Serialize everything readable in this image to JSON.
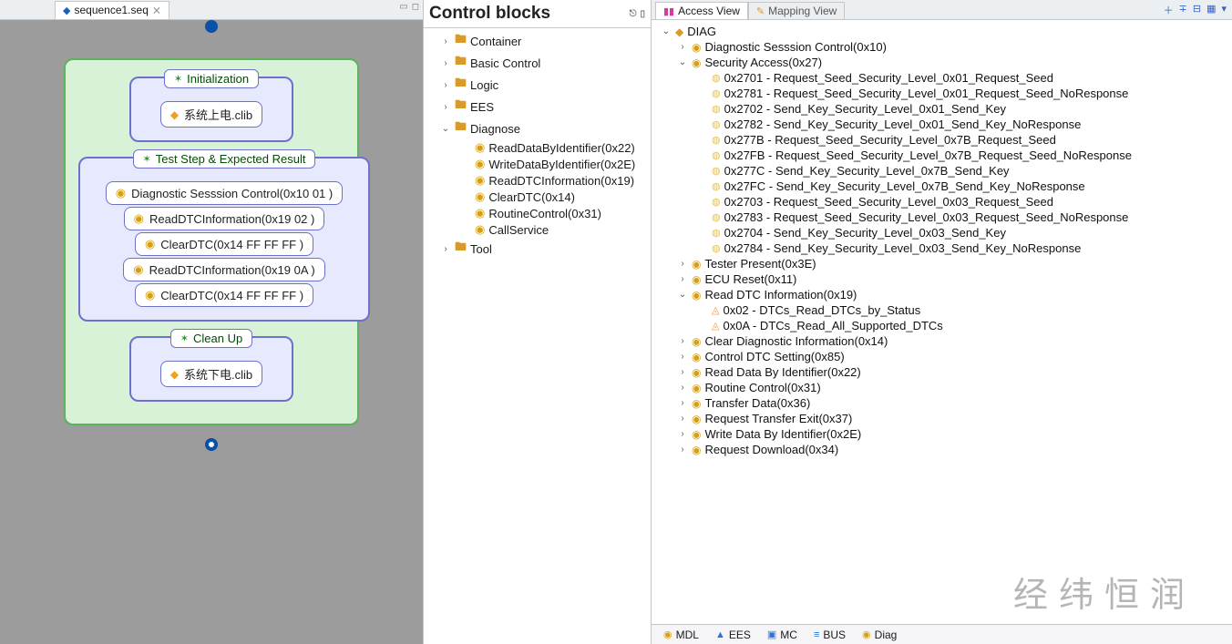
{
  "editor": {
    "tab_title": "sequence1.seq",
    "phases": {
      "init": {
        "title": "Initialization",
        "block": "系统上电.clib"
      },
      "test": {
        "title": "Test Step & Expected Result",
        "steps": [
          "Diagnostic Sesssion Control(0x10 01 )",
          "ReadDTCInformation(0x19 02 )",
          "ClearDTC(0x14 FF FF FF )",
          "ReadDTCInformation(0x19 0A )",
          "ClearDTC(0x14 FF FF FF )"
        ]
      },
      "cleanup": {
        "title": "Clean Up",
        "block": "系统下电.clib"
      }
    }
  },
  "palette": {
    "title": "Control blocks",
    "items": [
      {
        "label": "Container",
        "type": "folder",
        "depth": 1,
        "tw": "›"
      },
      {
        "label": "Basic Control",
        "type": "folder",
        "depth": 1,
        "tw": "›"
      },
      {
        "label": "Logic",
        "type": "folder",
        "depth": 1,
        "tw": "›"
      },
      {
        "label": "EES",
        "type": "folder",
        "depth": 1,
        "tw": "›"
      },
      {
        "label": "Diagnose",
        "type": "folder",
        "depth": 1,
        "tw": "⌄"
      },
      {
        "label": "ReadDataByIdentifier(0x22)",
        "type": "leaf",
        "depth": 2,
        "tw": ""
      },
      {
        "label": "WriteDataByIdentifier(0x2E)",
        "type": "leaf",
        "depth": 2,
        "tw": ""
      },
      {
        "label": "ReadDTCInformation(0x19)",
        "type": "leaf",
        "depth": 2,
        "tw": ""
      },
      {
        "label": "ClearDTC(0x14)",
        "type": "leaf",
        "depth": 2,
        "tw": ""
      },
      {
        "label": "RoutineControl(0x31)",
        "type": "leaf",
        "depth": 2,
        "tw": ""
      },
      {
        "label": "CallService",
        "type": "leaf",
        "depth": 2,
        "tw": ""
      },
      {
        "label": "Tool",
        "type": "folder",
        "depth": 1,
        "tw": "›"
      }
    ]
  },
  "views": {
    "tabs": {
      "access": "Access View",
      "mapping": "Mapping View"
    },
    "toolbar_icons": [
      "plus-icon",
      "filter-icon",
      "collapse-icon",
      "grid-icon",
      "menu-icon"
    ],
    "tree": [
      {
        "d": 0,
        "tw": "⌄",
        "ic": "iYellow",
        "g": "◆",
        "lbl": "DIAG"
      },
      {
        "d": 1,
        "tw": "›",
        "ic": "iGear",
        "g": "◉",
        "lbl": "Diagnostic Sesssion Control(0x10)"
      },
      {
        "d": 1,
        "tw": "⌄",
        "ic": "iGear",
        "g": "◉",
        "lbl": "Security Access(0x27)"
      },
      {
        "d": 2,
        "tw": "",
        "ic": "iCirc",
        "g": "◍",
        "lbl": "0x2701 - Request_Seed_Security_Level_0x01_Request_Seed"
      },
      {
        "d": 2,
        "tw": "",
        "ic": "iCirc",
        "g": "◍",
        "lbl": "0x2781 - Request_Seed_Security_Level_0x01_Request_Seed_NoResponse"
      },
      {
        "d": 2,
        "tw": "",
        "ic": "iCirc",
        "g": "◍",
        "lbl": "0x2702 - Send_Key_Security_Level_0x01_Send_Key"
      },
      {
        "d": 2,
        "tw": "",
        "ic": "iCirc",
        "g": "◍",
        "lbl": "0x2782 - Send_Key_Security_Level_0x01_Send_Key_NoResponse"
      },
      {
        "d": 2,
        "tw": "",
        "ic": "iCirc",
        "g": "◍",
        "lbl": "0x277B - Request_Seed_Security_Level_0x7B_Request_Seed"
      },
      {
        "d": 2,
        "tw": "",
        "ic": "iCirc",
        "g": "◍",
        "lbl": "0x27FB - Request_Seed_Security_Level_0x7B_Request_Seed_NoResponse"
      },
      {
        "d": 2,
        "tw": "",
        "ic": "iCirc",
        "g": "◍",
        "lbl": "0x277C - Send_Key_Security_Level_0x7B_Send_Key"
      },
      {
        "d": 2,
        "tw": "",
        "ic": "iCirc",
        "g": "◍",
        "lbl": "0x27FC - Send_Key_Security_Level_0x7B_Send_Key_NoResponse"
      },
      {
        "d": 2,
        "tw": "",
        "ic": "iCirc",
        "g": "◍",
        "lbl": "0x2703 - Request_Seed_Security_Level_0x03_Request_Seed"
      },
      {
        "d": 2,
        "tw": "",
        "ic": "iCirc",
        "g": "◍",
        "lbl": "0x2783 - Request_Seed_Security_Level_0x03_Request_Seed_NoResponse"
      },
      {
        "d": 2,
        "tw": "",
        "ic": "iCirc",
        "g": "◍",
        "lbl": "0x2704 - Send_Key_Security_Level_0x03_Send_Key"
      },
      {
        "d": 2,
        "tw": "",
        "ic": "iCirc",
        "g": "◍",
        "lbl": "0x2784 - Send_Key_Security_Level_0x03_Send_Key_NoResponse"
      },
      {
        "d": 1,
        "tw": "›",
        "ic": "iGear",
        "g": "◉",
        "lbl": "Tester Present(0x3E)"
      },
      {
        "d": 1,
        "tw": "›",
        "ic": "iGear",
        "g": "◉",
        "lbl": "ECU Reset(0x11)"
      },
      {
        "d": 1,
        "tw": "⌄",
        "ic": "iGear",
        "g": "◉",
        "lbl": "Read DTC Information(0x19)"
      },
      {
        "d": 2,
        "tw": "",
        "ic": "iTri",
        "g": "◬",
        "lbl": "0x02 - DTCs_Read_DTCs_by_Status"
      },
      {
        "d": 2,
        "tw": "",
        "ic": "iTri",
        "g": "◬",
        "lbl": "0x0A - DTCs_Read_All_Supported_DTCs"
      },
      {
        "d": 1,
        "tw": "›",
        "ic": "iGear",
        "g": "◉",
        "lbl": "Clear Diagnostic Information(0x14)"
      },
      {
        "d": 1,
        "tw": "›",
        "ic": "iGear",
        "g": "◉",
        "lbl": "Control DTC Setting(0x85)"
      },
      {
        "d": 1,
        "tw": "›",
        "ic": "iGear",
        "g": "◉",
        "lbl": "Read Data By Identifier(0x22)"
      },
      {
        "d": 1,
        "tw": "›",
        "ic": "iGear",
        "g": "◉",
        "lbl": "Routine Control(0x31)"
      },
      {
        "d": 1,
        "tw": "›",
        "ic": "iGear",
        "g": "◉",
        "lbl": "Transfer Data(0x36)"
      },
      {
        "d": 1,
        "tw": "›",
        "ic": "iGear",
        "g": "◉",
        "lbl": "Request Transfer Exit(0x37)"
      },
      {
        "d": 1,
        "tw": "›",
        "ic": "iGear",
        "g": "◉",
        "lbl": "Write Data By Identifier(0x2E)"
      },
      {
        "d": 1,
        "tw": "›",
        "ic": "iGear",
        "g": "◉",
        "lbl": "Request Download(0x34)"
      }
    ]
  },
  "bottom_tabs": [
    {
      "ic": "◉",
      "color": "#d4a017",
      "lbl": "MDL"
    },
    {
      "ic": "▲",
      "color": "#2d72d9",
      "lbl": "EES"
    },
    {
      "ic": "▣",
      "color": "#2d72d9",
      "lbl": "MC"
    },
    {
      "ic": "≡",
      "color": "#2d72d9",
      "lbl": "BUS"
    },
    {
      "ic": "◉",
      "color": "#d4a017",
      "lbl": "Diag"
    }
  ],
  "watermark": "经纬恒润"
}
